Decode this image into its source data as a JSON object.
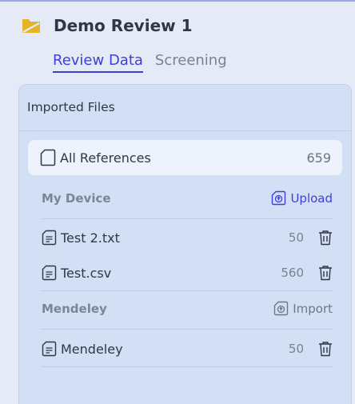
{
  "header": {
    "title": "Demo Review 1",
    "logo_icon": "folder-icon",
    "logo_color": "#e5b429"
  },
  "tabs": [
    {
      "label": "Review Data",
      "active": true
    },
    {
      "label": "Screening",
      "active": false
    }
  ],
  "panel": {
    "title": "Imported Files",
    "all_references": {
      "label": "All References",
      "count": "659"
    },
    "sections": [
      {
        "name": "My Device",
        "action_label": "Upload",
        "files": [
          {
            "name": "Test 2.txt",
            "count": "50"
          },
          {
            "name": "Test.csv",
            "count": "560"
          }
        ]
      },
      {
        "name": "Mendeley",
        "action_label": "Import",
        "files": [
          {
            "name": "Mendeley",
            "count": "50"
          }
        ]
      }
    ]
  },
  "colors": {
    "accent": "#3f3fd8",
    "panel_bg": "#d3dff5",
    "page_bg": "#e5eaf7"
  }
}
